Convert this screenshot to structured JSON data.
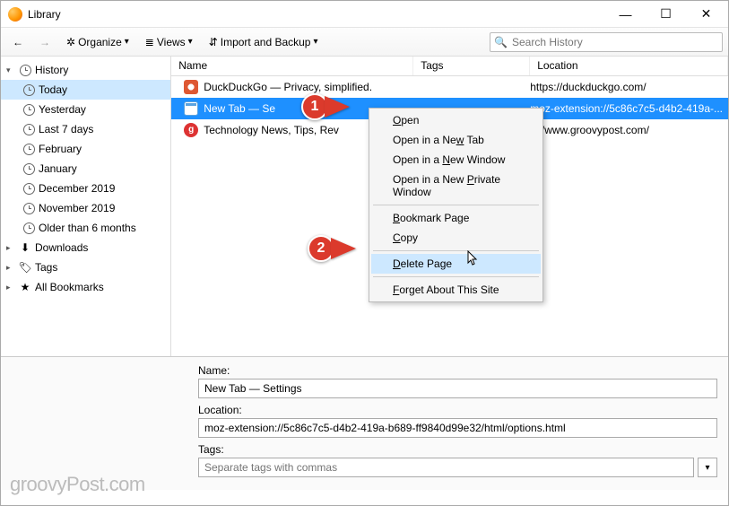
{
  "window": {
    "title": "Library"
  },
  "toolbar": {
    "organize": "Organize",
    "views": "Views",
    "import": "Import and Backup",
    "search_placeholder": "Search History"
  },
  "sidebar": {
    "history": "History",
    "items": [
      "Today",
      "Yesterday",
      "Last 7 days",
      "February",
      "January",
      "December 2019",
      "November 2019",
      "Older than 6 months"
    ],
    "downloads": "Downloads",
    "tags": "Tags",
    "bookmarks": "All Bookmarks"
  },
  "columns": {
    "name": "Name",
    "tags": "Tags",
    "location": "Location"
  },
  "rows": [
    {
      "title": "DuckDuckGo — Privacy, simplified.",
      "loc": "https://duckduckgo.com/",
      "icon": "ddg"
    },
    {
      "title": "New Tab — Se",
      "loc": "moz-extension://5c86c7c5-d4b2-419a-...",
      "icon": "tab"
    },
    {
      "title": "Technology News, Tips, Rev",
      "loc": "s://www.groovypost.com/",
      "icon": "gp"
    }
  ],
  "ctx": {
    "open": "pen",
    "open_tab_pre": "Open in a Ne",
    "open_tab_u": "w",
    "open_tab_post": " Tab",
    "open_win_pre": "Open in a ",
    "open_win_u": "N",
    "open_win_post": "ew Window",
    "open_priv": "Open in a New ",
    "open_priv_u": "P",
    "open_priv_post": "rivate Window",
    "bookmark_u": "B",
    "bookmark": "ookmark Page",
    "copy_u": "C",
    "copy": "opy",
    "delete_u": "D",
    "delete": "elete Page",
    "forget_u": "F",
    "forget": "orget About This Site"
  },
  "callouts": {
    "one": "1",
    "two": "2"
  },
  "details": {
    "name_label": "Name:",
    "name_value": "New Tab — Settings",
    "loc_label": "Location:",
    "loc_value": "moz-extension://5c86c7c5-d4b2-419a-b689-ff9840d99e32/html/options.html",
    "tags_label": "Tags:",
    "tags_placeholder": "Separate tags with commas"
  },
  "watermark": "groovyPost.com"
}
